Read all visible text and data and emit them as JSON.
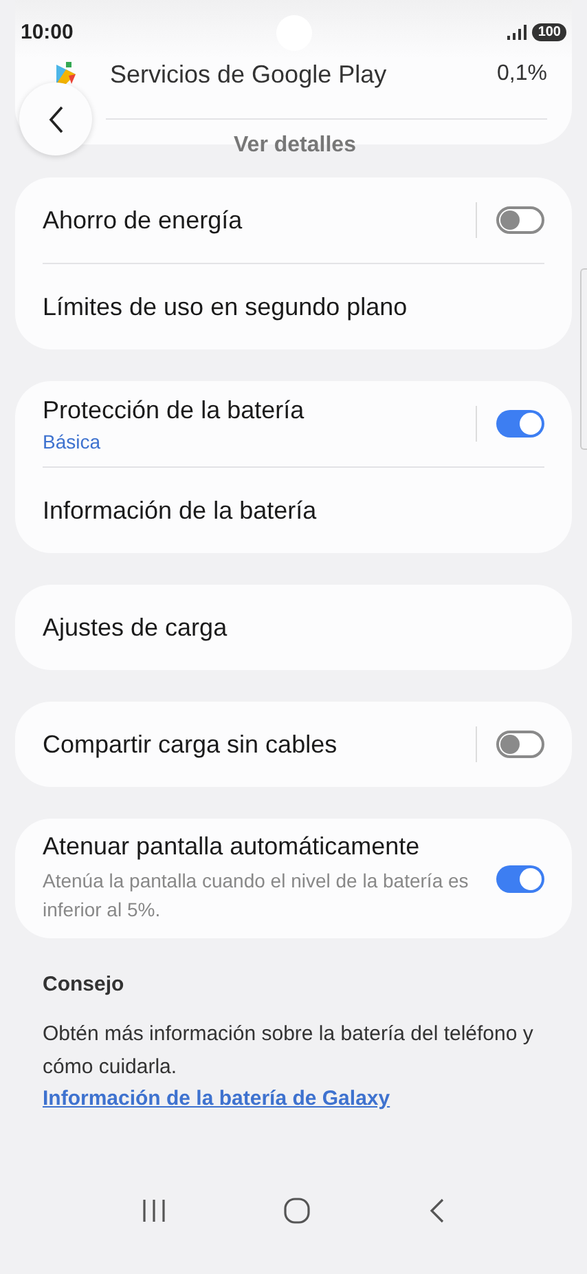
{
  "status_bar": {
    "time": "10:00",
    "battery": "100"
  },
  "app_card": {
    "app_name": "Servicios de Google Play",
    "usage": "0,1%",
    "details_button": "Ver detalles"
  },
  "groups": [
    {
      "items": [
        {
          "kind": "split-toggle",
          "title": "Ahorro de energía",
          "on": false
        },
        {
          "kind": "link",
          "title": "Límites de uso en segundo plano"
        }
      ]
    },
    {
      "items": [
        {
          "kind": "split-toggle",
          "title": "Protección de la batería",
          "status": "Básica",
          "on": true
        },
        {
          "kind": "link",
          "title": "Información de la batería"
        }
      ]
    },
    {
      "items": [
        {
          "kind": "link",
          "title": "Ajustes de carga"
        }
      ]
    },
    {
      "items": [
        {
          "kind": "split-toggle",
          "title": "Compartir carga sin cables",
          "on": false
        }
      ]
    },
    {
      "items": [
        {
          "kind": "toggle",
          "title": "Atenuar pantalla automáticamente",
          "description": "Atenúa la pantalla cuando el nivel de la batería es inferior al 5%.",
          "on": true
        }
      ]
    }
  ],
  "tip": {
    "heading": "Consejo",
    "text": "Obtén más información sobre la batería del teléfono y cómo cuidarla.",
    "link": "Información de la batería de Galaxy"
  }
}
